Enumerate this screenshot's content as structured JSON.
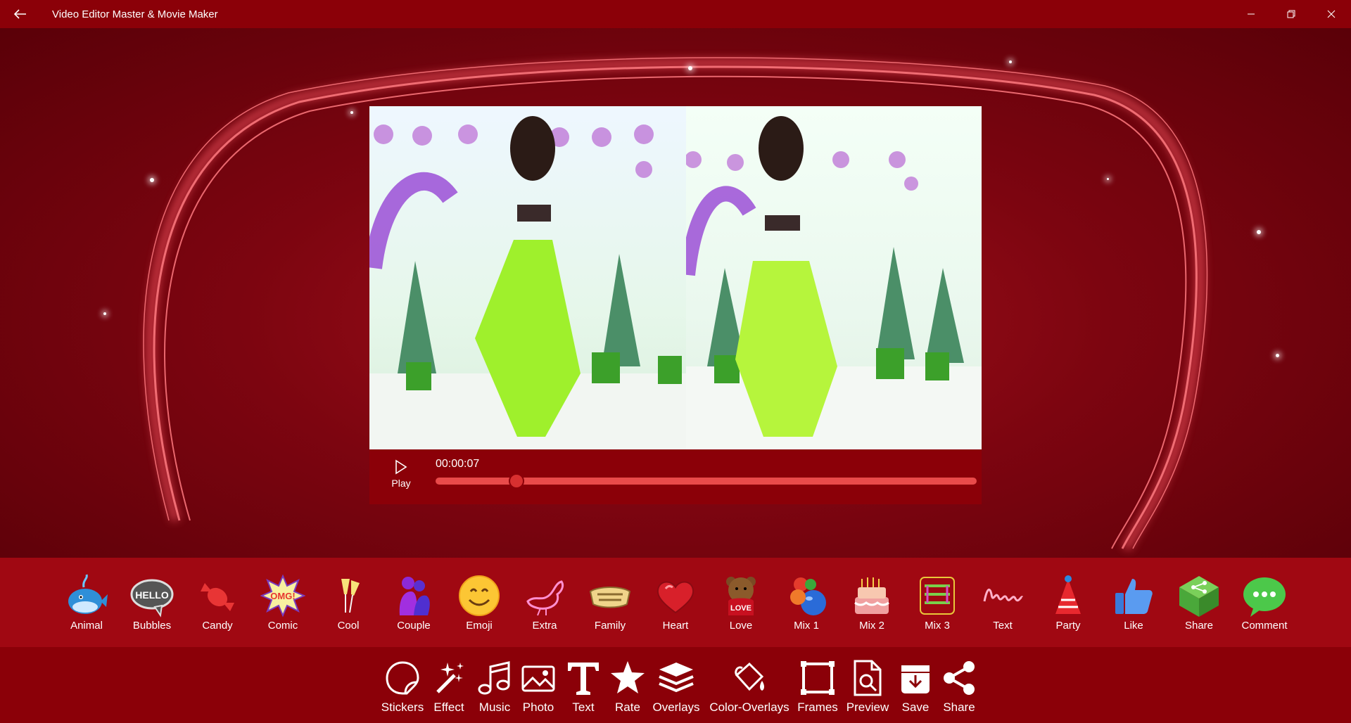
{
  "window": {
    "title": "Video Editor Master & Movie Maker"
  },
  "player": {
    "time": "00:00:07",
    "play_label": "Play",
    "progress": 0.15
  },
  "stickers": [
    {
      "label": "Animal",
      "icon": "whale-icon"
    },
    {
      "label": "Bubbles",
      "icon": "hello-bubble-icon"
    },
    {
      "label": "Candy",
      "icon": "candy-icon"
    },
    {
      "label": "Comic",
      "icon": "omg-comic-icon"
    },
    {
      "label": "Cool",
      "icon": "champagne-icon"
    },
    {
      "label": "Couple",
      "icon": "couple-icon"
    },
    {
      "label": "Emoji",
      "icon": "smiley-icon"
    },
    {
      "label": "Extra",
      "icon": "bird-icon"
    },
    {
      "label": "Family",
      "icon": "family-text-icon"
    },
    {
      "label": "Heart",
      "icon": "heart-icon"
    },
    {
      "label": "Love",
      "icon": "love-bear-icon"
    },
    {
      "label": "Mix 1",
      "icon": "balls-icon"
    },
    {
      "label": "Mix 2",
      "icon": "cake-icon"
    },
    {
      "label": "Mix 3",
      "icon": "peace-text-icon"
    },
    {
      "label": "Text",
      "icon": "kiss-text-icon"
    },
    {
      "label": "Party",
      "icon": "party-hat-icon"
    },
    {
      "label": "Like",
      "icon": "thumbs-up-icon"
    },
    {
      "label": "Share",
      "icon": "share-cube-icon"
    },
    {
      "label": "Comment",
      "icon": "comment-bubble-icon"
    }
  ],
  "sticker_art": {
    "hello": "HELLO",
    "omg": "OMG!",
    "love": "LOVE"
  },
  "tools": [
    {
      "label": "Stickers",
      "icon": "sticker-icon"
    },
    {
      "label": "Effect",
      "icon": "magic-wand-icon"
    },
    {
      "label": "Music",
      "icon": "music-note-icon"
    },
    {
      "label": "Photo",
      "icon": "photo-icon"
    },
    {
      "label": "Text",
      "icon": "text-icon"
    },
    {
      "label": "Rate",
      "icon": "star-icon"
    },
    {
      "label": "Overlays",
      "icon": "layers-icon"
    },
    {
      "label": "Color-Overlays",
      "icon": "paint-bucket-icon"
    },
    {
      "label": "Frames",
      "icon": "frame-icon"
    },
    {
      "label": "Preview",
      "icon": "preview-icon"
    },
    {
      "label": "Save",
      "icon": "save-icon"
    },
    {
      "label": "Share",
      "icon": "share-icon"
    }
  ],
  "colors": {
    "titlebar": "#8b0008",
    "sticker_bar": "#a00812",
    "seek": "#e94a4a"
  }
}
